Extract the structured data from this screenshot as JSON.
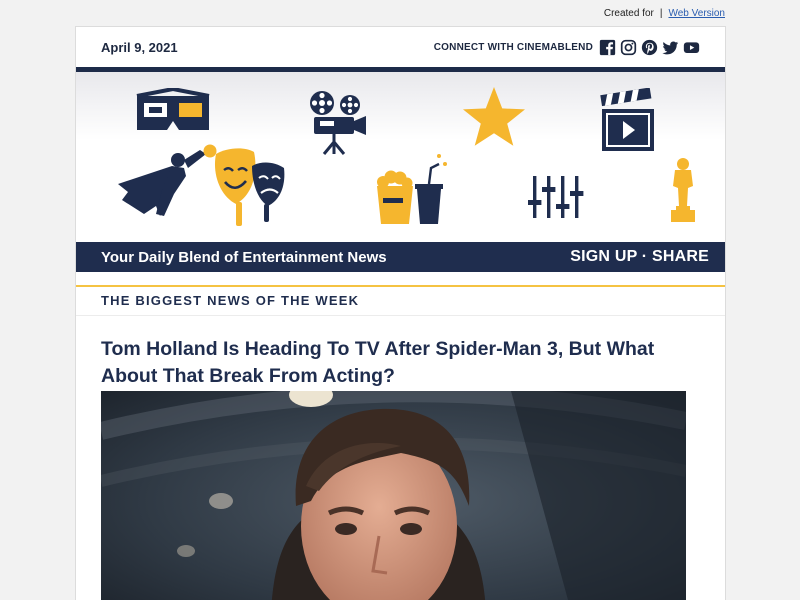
{
  "preheader": {
    "created_for": "Created for",
    "separator": "|",
    "web_version": "Web Version"
  },
  "header": {
    "date": "April 9, 2021",
    "connect_label": "CONNECT WITH CINEMABLEND",
    "social_icons": [
      "facebook-icon",
      "instagram-icon",
      "pinterest-icon",
      "twitter-icon",
      "youtube-icon"
    ]
  },
  "banner": {
    "icons": [
      "3d-glasses-icon",
      "film-projector-icon",
      "star-icon",
      "clapperboard-icon",
      "superhero-icon",
      "theater-masks-icon",
      "popcorn-soda-icon",
      "equalizer-icon",
      "award-statue-icon"
    ]
  },
  "tagline_bar": {
    "tagline": "Your Daily Blend of Entertainment News",
    "cta": "SIGN UP · SHARE"
  },
  "section": {
    "label": "THE BIGGEST NEWS OF THE WEEK"
  },
  "article": {
    "headline": "Tom Holland Is Heading To TV After Spider-Man 3, But What About That Break From Acting?"
  },
  "colors": {
    "navy": "#1f2d4e",
    "gold": "#f5c342",
    "link": "#2a5db0"
  }
}
